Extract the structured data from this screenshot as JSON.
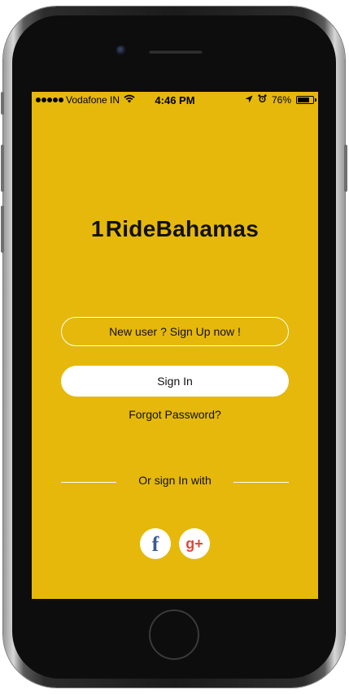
{
  "status_bar": {
    "carrier": "Vodafone IN",
    "wifi_icon": "wifi-icon",
    "time": "4:46 PM",
    "battery_percent": "76%",
    "battery_level": 0.76,
    "location_icon": "location-arrow-icon",
    "alarm_icon": "alarm-clock-icon"
  },
  "brand": {
    "mark": "1",
    "name": "Ride Bahamas",
    "name_display": "RideBahamas"
  },
  "auth": {
    "signup_label": "New user ? Sign Up now !",
    "signin_label": "Sign In",
    "forgot_label": "Forgot Password?",
    "or_label": "Or sign In with"
  },
  "social": {
    "facebook_glyph": "f",
    "google_glyph": "g+"
  },
  "colors": {
    "screen_background": "#e5b80b",
    "button_white": "#ffffff",
    "facebook_blue": "#3b5998",
    "google_red": "#dd4b39"
  }
}
